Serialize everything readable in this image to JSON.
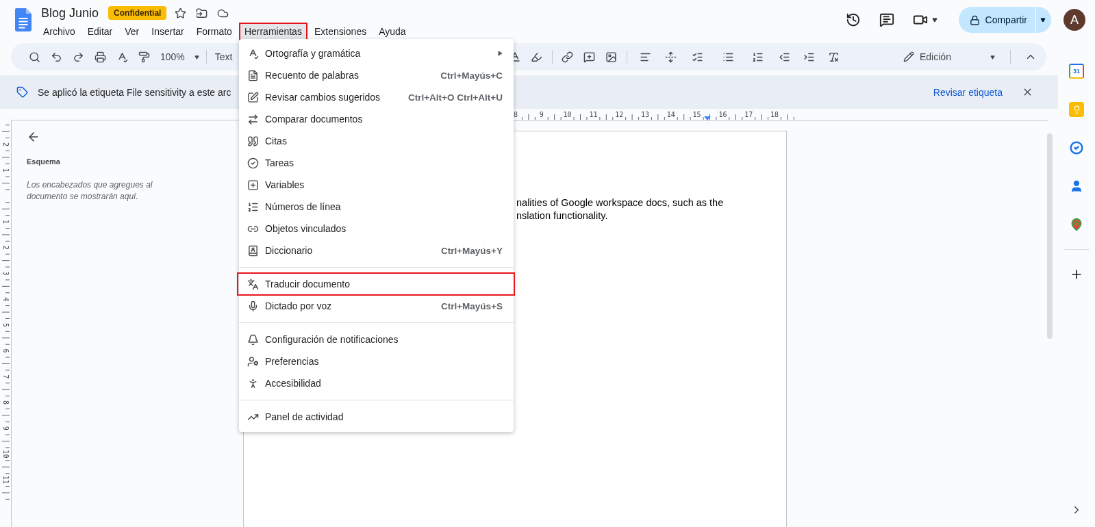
{
  "document": {
    "title": "Blog Junio",
    "badge": "Confidential"
  },
  "menubar": [
    {
      "label": "Archivo",
      "selected": false,
      "annotated": false
    },
    {
      "label": "Editar",
      "selected": false,
      "annotated": false
    },
    {
      "label": "Ver",
      "selected": false,
      "annotated": false
    },
    {
      "label": "Insertar",
      "selected": false,
      "annotated": false
    },
    {
      "label": "Formato",
      "selected": false,
      "annotated": false
    },
    {
      "label": "Herramientas",
      "selected": true,
      "annotated": true
    },
    {
      "label": "Extensiones",
      "selected": false,
      "annotated": false
    },
    {
      "label": "Ayuda",
      "selected": false,
      "annotated": false
    }
  ],
  "header_actions": {
    "share": "Compartir",
    "avatar": "A"
  },
  "toolbar": {
    "zoom": "100%",
    "style": "Text",
    "mode": "Edición"
  },
  "banner": {
    "message": "Se aplicó la etiqueta File sensitivity a este arc",
    "action": "Revisar etiqueta"
  },
  "ruler": {
    "horizontal": [
      "8",
      "9",
      "10",
      "11",
      "12",
      "13",
      "14",
      "15",
      "16",
      "17",
      "18"
    ],
    "vertical": [
      "2",
      "1",
      "1",
      "2",
      "3",
      "4",
      "5",
      "6",
      "7",
      "8",
      "9",
      "10",
      "11"
    ]
  },
  "outline": {
    "title": "Esquema",
    "empty_message": "Los encabezados que agregues al documento se mostrarán aquí."
  },
  "document_body": {
    "lines": [
      "nalities of Google workspace docs, such as the",
      "nslation functionality."
    ]
  },
  "tools_menu": {
    "groups": [
      [
        {
          "label": "Ortografía y gramática",
          "submenu": true,
          "annotated": false
        },
        {
          "label": "Recuento de palabras",
          "shortcut": "Ctrl+Mayús+C",
          "annotated": false
        },
        {
          "label": "Revisar cambios sugeridos",
          "shortcut": "Ctrl+Alt+O Ctrl+Alt+U",
          "annotated": false
        },
        {
          "label": "Comparar documentos",
          "annotated": false
        },
        {
          "label": "Citas",
          "annotated": false
        },
        {
          "label": "Tareas",
          "annotated": false
        },
        {
          "label": "Variables",
          "annotated": false
        },
        {
          "label": "Números de línea",
          "annotated": false
        },
        {
          "label": "Objetos vinculados",
          "annotated": false
        },
        {
          "label": "Diccionario",
          "shortcut": "Ctrl+Mayús+Y",
          "annotated": false
        }
      ],
      [
        {
          "label": "Traducir documento",
          "annotated": true
        },
        {
          "label": "Dictado por voz",
          "shortcut": "Ctrl+Mayús+S",
          "annotated": false
        }
      ],
      [
        {
          "label": "Configuración de notificaciones",
          "annotated": false
        },
        {
          "label": "Preferencias",
          "annotated": false
        },
        {
          "label": "Accesibilidad",
          "annotated": false
        }
      ],
      [
        {
          "label": "Panel de actividad",
          "annotated": false
        }
      ]
    ]
  },
  "side_panel": {
    "calendar_day": "31"
  }
}
